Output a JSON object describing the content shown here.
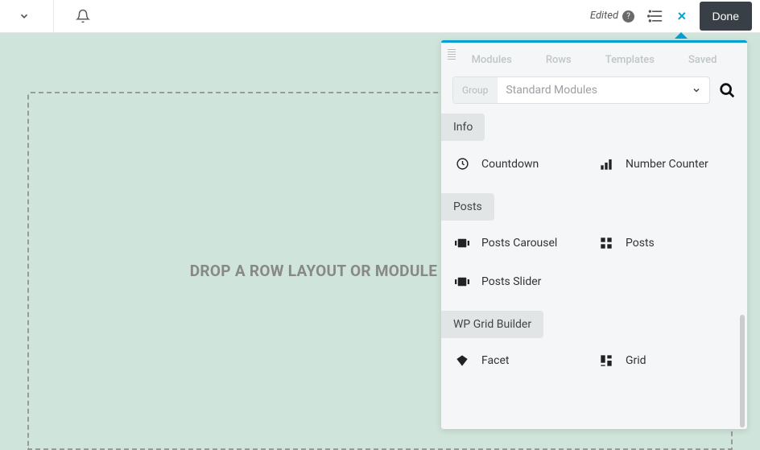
{
  "header": {
    "edited": "Edited",
    "done": "Done"
  },
  "panel": {
    "tabs": [
      "Modules",
      "Rows",
      "Templates",
      "Saved"
    ],
    "group_label": "Group",
    "filter_value": "Standard Modules",
    "sections": [
      {
        "title": "Info",
        "modules": [
          {
            "icon": "clock",
            "label": "Countdown"
          },
          {
            "icon": "bars-asc",
            "label": "Number Counter"
          }
        ]
      },
      {
        "title": "Posts",
        "modules": [
          {
            "icon": "carousel",
            "label": "Posts Carousel"
          },
          {
            "icon": "grid2",
            "label": "Posts"
          },
          {
            "icon": "carousel",
            "label": "Posts Slider"
          }
        ]
      },
      {
        "title": "WP Grid Builder",
        "modules": [
          {
            "icon": "diamond",
            "label": "Facet"
          },
          {
            "icon": "grid3",
            "label": "Grid"
          }
        ]
      }
    ]
  },
  "canvas": {
    "placeholder": "DROP A ROW LAYOUT OR MODULE TO GET STARTED!"
  }
}
